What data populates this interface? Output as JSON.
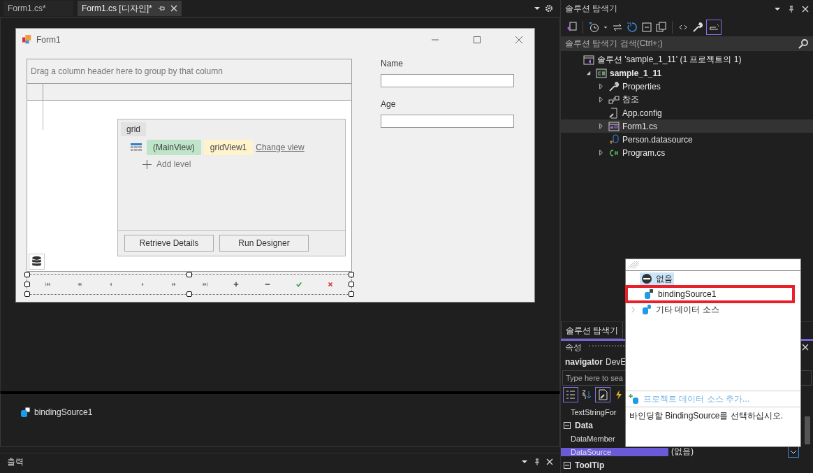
{
  "tabs": [
    {
      "label": "Form1.cs*",
      "selected": false
    },
    {
      "label": "Form1.cs [디자인]*",
      "selected": true
    }
  ],
  "form": {
    "title": "Form1",
    "group_panel": "Drag a column header here to group by that column",
    "designer": {
      "tab": "grid",
      "main_view": "(MainView)",
      "view_name": "gridView1",
      "change_view": "Change view",
      "add_level": "Add level",
      "buttons": [
        "Retrieve Details",
        "Run Designer"
      ]
    },
    "navigator": [
      {
        "kind": "first"
      },
      {
        "kind": "prev-page"
      },
      {
        "kind": "prev"
      },
      {
        "kind": "next"
      },
      {
        "kind": "next-page"
      },
      {
        "kind": "last"
      },
      {
        "kind": "append"
      },
      {
        "kind": "remove"
      },
      {
        "kind": "end-edit"
      },
      {
        "kind": "cancel-edit"
      }
    ],
    "fields": [
      {
        "label": "Name"
      },
      {
        "label": "Age"
      }
    ]
  },
  "component_tray": [
    {
      "label": "bindingSource1"
    }
  ],
  "output_panel": {
    "title": "출력"
  },
  "solution_explorer": {
    "title": "솔루션 탐색기",
    "search_placeholder": "솔루션 탐색기 검색(Ctrl+;)",
    "bottom_tab": "솔루션 탐색기",
    "tree": [
      {
        "kind": "solution",
        "label": "솔루션 'sample_1_11' (1 프로젝트의 1)",
        "selected": false,
        "children": [
          {
            "kind": "project",
            "label": "sample_1_11",
            "expanded": true,
            "selected": false,
            "children": [
              {
                "kind": "properties",
                "label": "Properties",
                "expanded": false,
                "selected": false
              },
              {
                "kind": "references",
                "label": "참조",
                "expanded": false,
                "selected": false
              },
              {
                "kind": "config",
                "label": "App.config",
                "selected": false
              },
              {
                "kind": "form",
                "label": "Form1.cs",
                "expanded": false,
                "selected": true
              },
              {
                "kind": "datasource",
                "label": "Person.datasource",
                "selected": false
              },
              {
                "kind": "csharp",
                "label": "Program.cs",
                "expanded": false,
                "selected": false
              }
            ]
          }
        ]
      }
    ]
  },
  "properties": {
    "title": "속성",
    "object": "navigator",
    "type": "DevE",
    "search_placeholder": "Type here to sea",
    "rows": [
      {
        "kind": "property",
        "name": "TextStringFor",
        "selected": false
      },
      {
        "kind": "category",
        "name": "Data",
        "expanded": true
      },
      {
        "kind": "property",
        "name": "DataMember",
        "selected": false
      },
      {
        "kind": "property",
        "name": "DataSource",
        "value": "(없음)",
        "selected": true
      },
      {
        "kind": "category",
        "name": "ToolTip",
        "expanded": true
      }
    ]
  },
  "dropdown": {
    "items": [
      {
        "kind": "none",
        "label": "없음",
        "selected": true,
        "highlighted": false
      },
      {
        "kind": "binding",
        "label": "bindingSource1",
        "selected": false,
        "highlighted": true
      },
      {
        "kind": "folder",
        "label": "기타 데이터 소스",
        "selected": false,
        "highlighted": false
      }
    ],
    "add_link": "프로젝트 데이터 소스 추가...",
    "description": "바인딩할 BindingSource를 선택하십시오."
  }
}
